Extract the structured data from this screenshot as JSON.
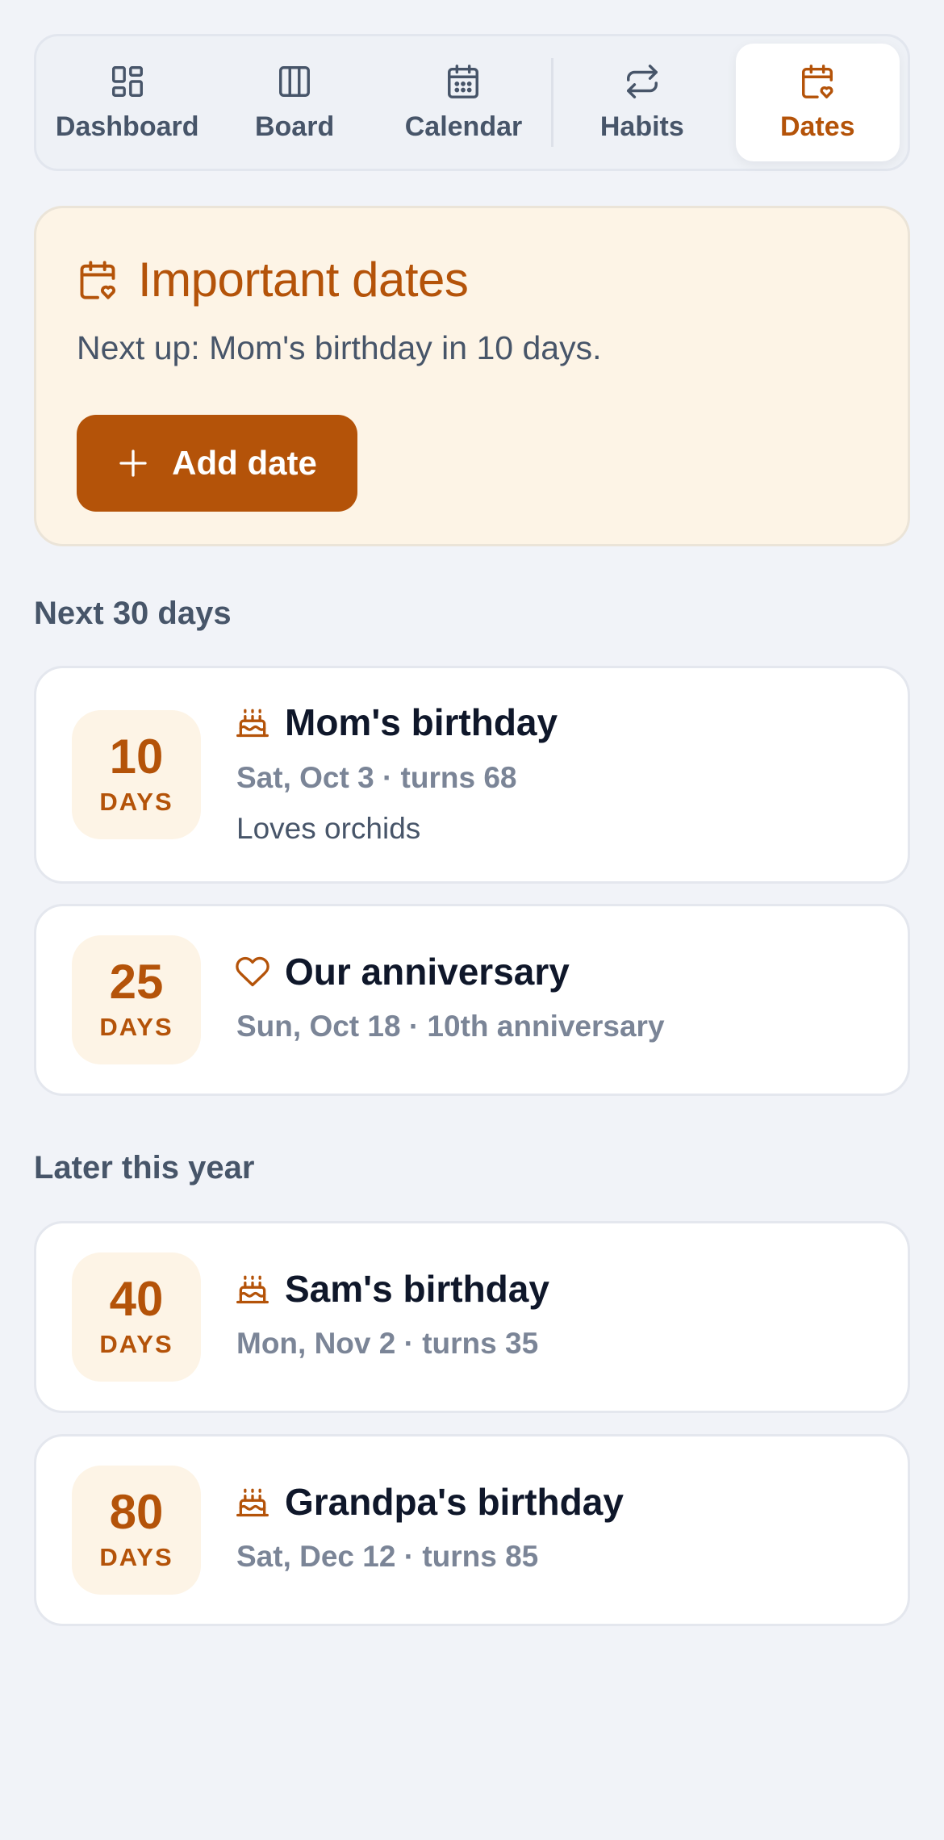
{
  "nav": {
    "items": [
      {
        "label": "Dashboard",
        "icon": "dashboard-icon"
      },
      {
        "label": "Board",
        "icon": "board-columns-icon"
      },
      {
        "label": "Calendar",
        "icon": "calendar-icon"
      },
      {
        "label": "Habits",
        "icon": "repeat-icon"
      },
      {
        "label": "Dates",
        "icon": "calendar-heart-icon"
      }
    ],
    "active": "Dates"
  },
  "hero": {
    "title": "Important dates",
    "subtitle": "Next up: Mom's birthday in 10 days.",
    "button_label": "Add date"
  },
  "sections": [
    {
      "title": "Next 30 days",
      "events": [
        {
          "days": "10",
          "unit": "DAYS",
          "icon": "cake-icon",
          "title": "Mom's birthday",
          "meta": "Sat, Oct 3 · turns 68",
          "note": "Loves orchids"
        },
        {
          "days": "25",
          "unit": "DAYS",
          "icon": "heart-icon",
          "title": "Our anniversary",
          "meta": "Sun, Oct 18 · 10th anniversary"
        }
      ]
    },
    {
      "title": "Later this year",
      "events": [
        {
          "days": "40",
          "unit": "DAYS",
          "icon": "cake-icon",
          "title": "Sam's birthday",
          "meta": "Mon, Nov 2 · turns 35"
        },
        {
          "days": "80",
          "unit": "DAYS",
          "icon": "cake-icon",
          "title": "Grandpa's birthday",
          "meta": "Sat, Dec 12 · turns 85"
        }
      ]
    }
  ],
  "colors": {
    "accent": "#b45309",
    "accent_soft": "#fdf4e6",
    "background": "#f1f3f8",
    "muted_text": "#7b8597",
    "body_text": "#475569"
  }
}
